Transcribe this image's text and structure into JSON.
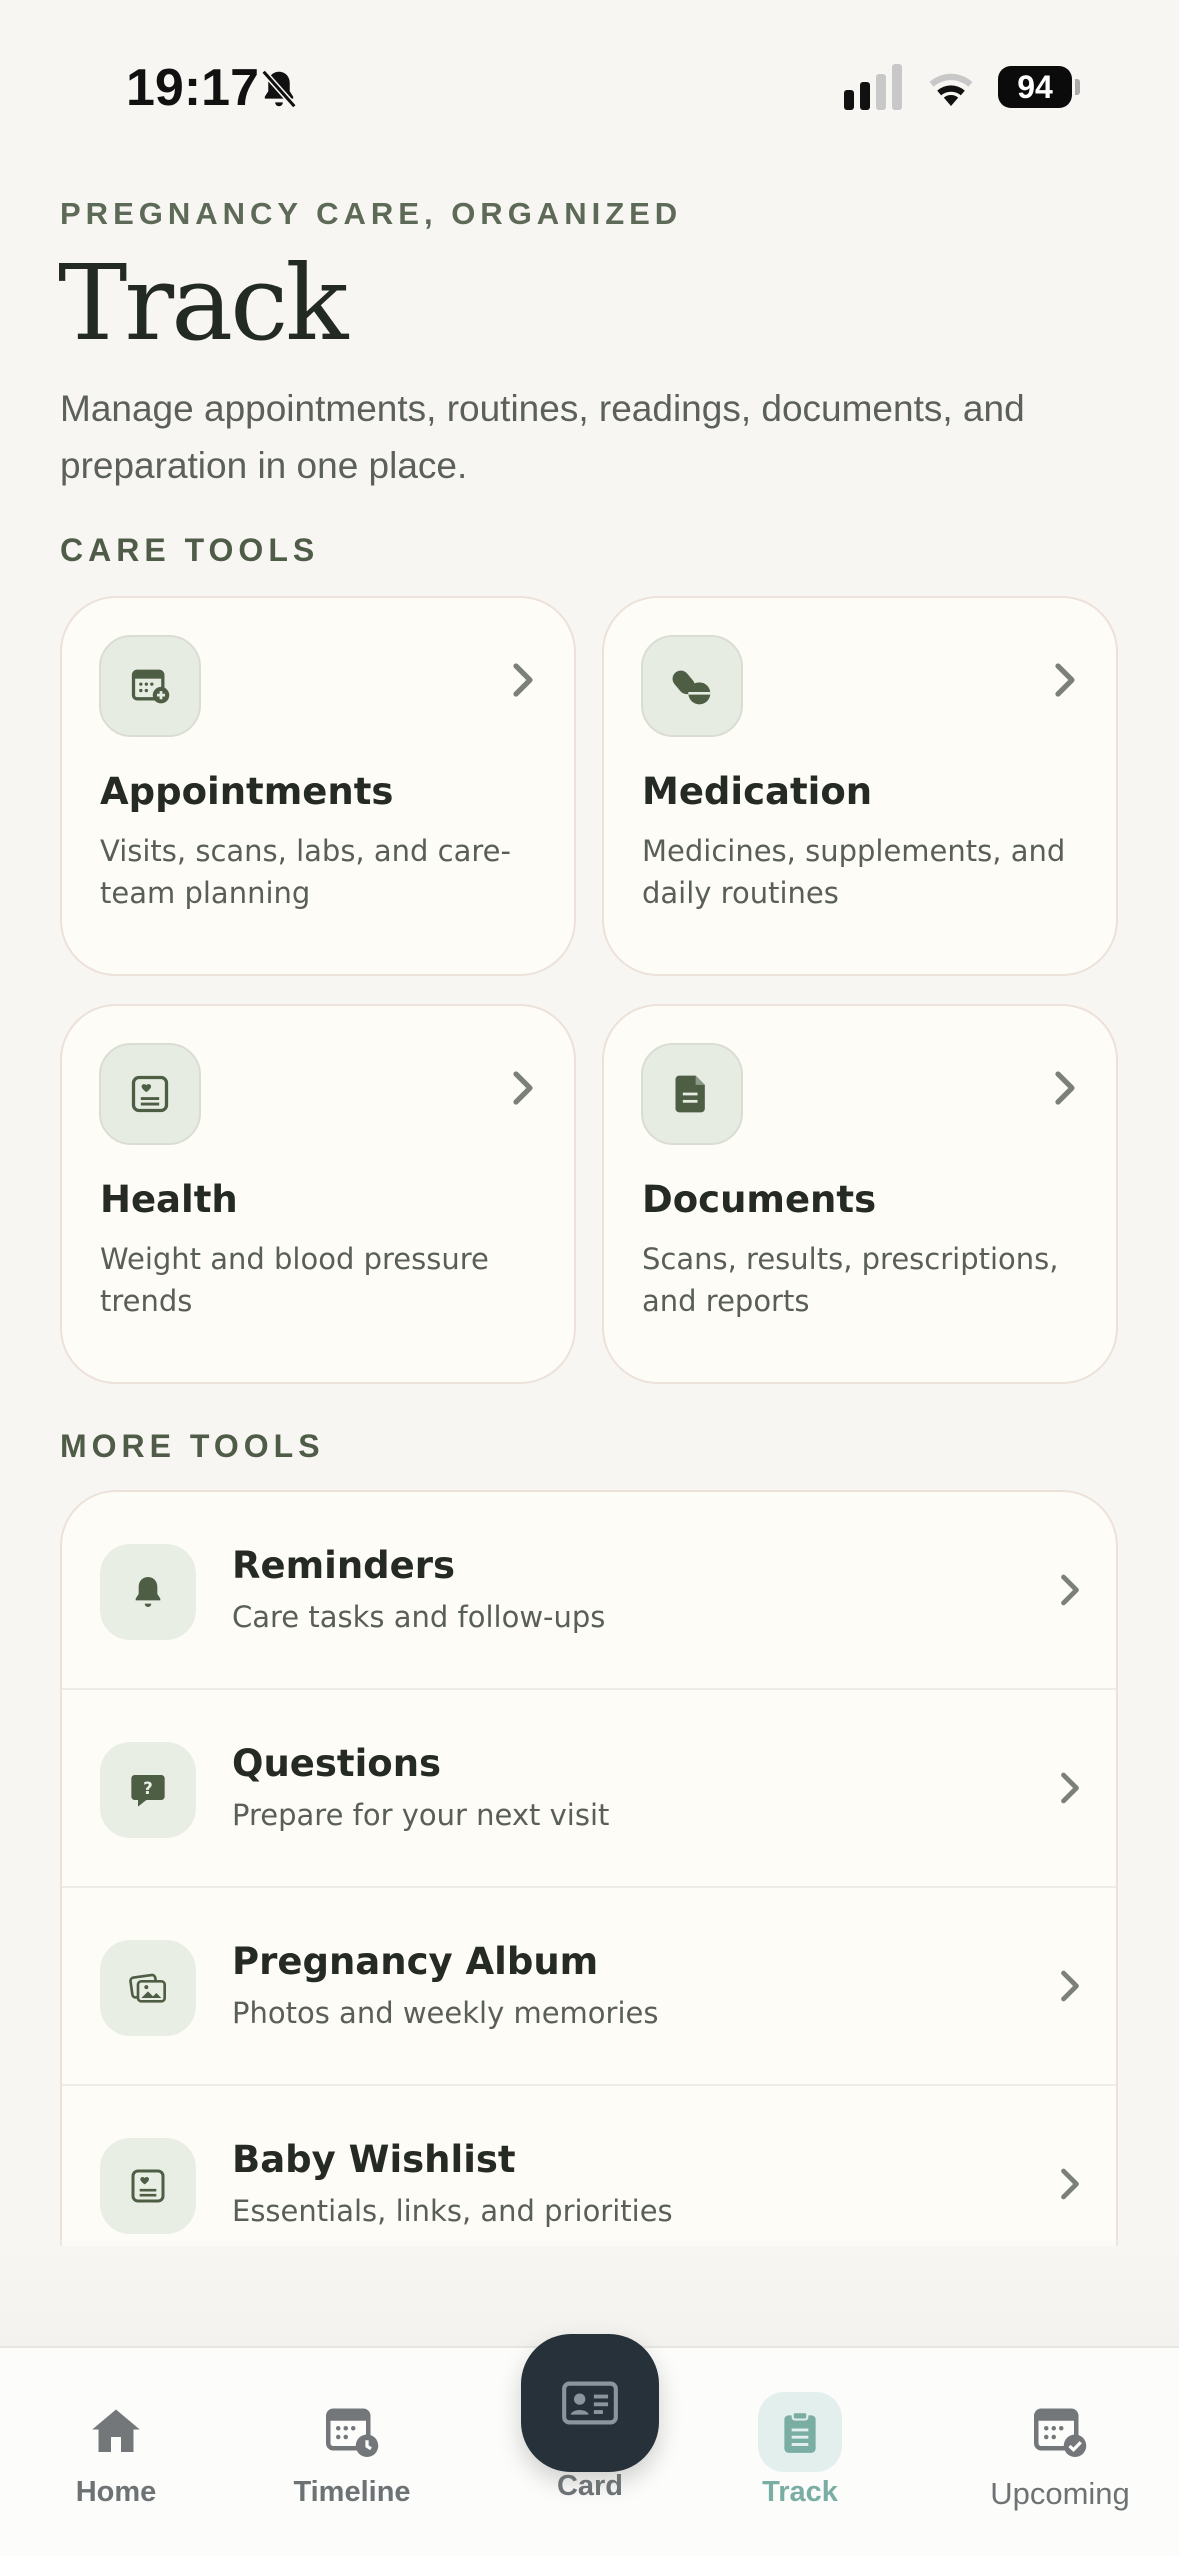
{
  "status_bar": {
    "time": "19:17",
    "battery": "94"
  },
  "header": {
    "eyebrow": "PREGNANCY CARE, ORGANIZED",
    "title": "Track",
    "subtitle": "Manage appointments, routines, readings, documents, and preparation in one place."
  },
  "care_tools": {
    "label": "CARE TOOLS",
    "cards": [
      {
        "title": "Appointments",
        "desc": "Visits, scans, labs, and care-team planning",
        "icon": "calendar-add-icon"
      },
      {
        "title": "Medication",
        "desc": "Medicines, supplements, and daily routines",
        "icon": "pill-icon"
      },
      {
        "title": "Health",
        "desc": "Weight and blood pressure trends",
        "icon": "health-card-icon"
      },
      {
        "title": "Documents",
        "desc": "Scans, results, prescriptions, and reports",
        "icon": "document-icon"
      }
    ]
  },
  "more_tools": {
    "label": "MORE TOOLS",
    "rows": [
      {
        "title": "Reminders",
        "sub": "Care tasks and follow-ups",
        "icon": "bell-icon"
      },
      {
        "title": "Questions",
        "sub": "Prepare for your next visit",
        "icon": "question-bubble-icon"
      },
      {
        "title": "Pregnancy Album",
        "sub": "Photos and weekly memories",
        "icon": "photos-icon"
      },
      {
        "title": "Baby Wishlist",
        "sub": "Essentials, links, and priorities",
        "icon": "wishlist-icon"
      }
    ]
  },
  "tab_bar": {
    "tabs": [
      {
        "label": "Home",
        "icon": "house-icon"
      },
      {
        "label": "Timeline",
        "icon": "calendar-clock-icon"
      },
      {
        "label": "Card",
        "icon": "id-card-icon"
      },
      {
        "label": "Track",
        "icon": "clipboard-icon",
        "active": true
      },
      {
        "label": "Upcoming",
        "icon": "calendar-check-icon"
      }
    ]
  },
  "colors": {
    "background": "#f8f6f2",
    "card": "#fefcf7",
    "accent_green": "#4e5e45",
    "active_tab": "#7aaea4",
    "fab": "#26313a"
  }
}
